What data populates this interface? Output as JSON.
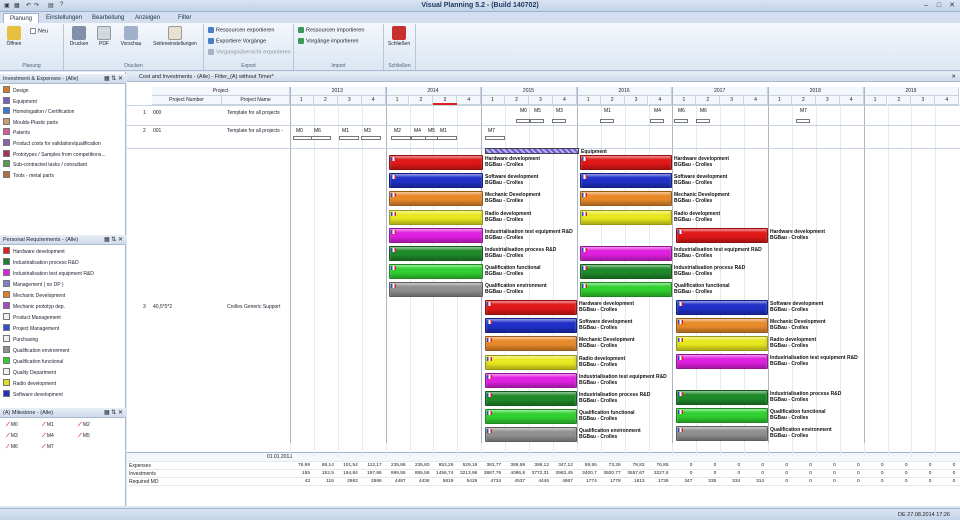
{
  "window": {
    "title": "Visual Planning 5.2 - (Build 140702)"
  },
  "tabs": [
    {
      "label": "Planung",
      "active": true
    },
    {
      "label": "Einstellungen"
    },
    {
      "label": "Bearbeitung"
    },
    {
      "label": "Anzeigen"
    },
    {
      "label": "Filter"
    }
  ],
  "ribbon": {
    "planung": {
      "label": "Planung",
      "open": "Öffnen",
      "new": "Neu"
    },
    "drucken": {
      "label": "Drucken",
      "print": "Drucken",
      "pdf": "PDF",
      "preview": "Vorschau",
      "page_setup": "Seiteneinstellungen"
    },
    "export": {
      "label": "Export",
      "res_export": "Ressourcen exportieren",
      "tasks_export": "Exportiere Vorgänge",
      "tasks_view_export": "Vorgangsübersicht exportieren"
    },
    "import": {
      "label": "Import",
      "res_import": "Ressourcen importieren",
      "tasks_import": "Vorgänge importieren"
    },
    "close": {
      "label": "Schließen",
      "close": "Schließen"
    }
  },
  "panels": {
    "invest": {
      "title": "Investment & Expenses - (Alle)",
      "items": [
        {
          "label": "Design",
          "color": "#d97a2a"
        },
        {
          "label": "Equipment",
          "color": "#7b5ec8"
        },
        {
          "label": "Homologation / Certification",
          "color": "#3a7ad8"
        },
        {
          "label": "Moulds-Plastic parts",
          "color": "#c8a070"
        },
        {
          "label": "Patents",
          "color": "#d85a9a"
        },
        {
          "label": "Product costs for validation/qualification",
          "color": "#9060b0"
        },
        {
          "label": "Prototypes / Samples from competitions...",
          "color": "#b03050"
        },
        {
          "label": "Sub-contracted tasks / consultant",
          "color": "#50a050"
        },
        {
          "label": "Tools - metal parts",
          "color": "#b07040"
        }
      ]
    },
    "personal": {
      "title": "Personal Requirements - (Alle)",
      "items": [
        {
          "label": "Hardware development",
          "color": "#e02020"
        },
        {
          "label": "Industrialisation process R&D",
          "color": "#208030"
        },
        {
          "label": "Industrialisation test equipment R&D",
          "color": "#e020e0"
        },
        {
          "label": "Management ( no DP )",
          "color": "#8080d0"
        },
        {
          "label": "Mechanic Development",
          "color": "#e08020"
        },
        {
          "label": "Mechanic prototyp dep.",
          "color": "#a050c0"
        },
        {
          "label": "Product Management",
          "color": "#f0f0f0"
        },
        {
          "label": "Project Management",
          "color": "#3050d0"
        },
        {
          "label": "Purchasing",
          "color": "#f0f0f0"
        },
        {
          "label": "Qualification environment",
          "color": "#909090"
        },
        {
          "label": "Qualification functional",
          "color": "#30d030"
        },
        {
          "label": "Quality Department",
          "color": "#f0f0f0"
        },
        {
          "label": "Radio development",
          "color": "#e0e020"
        },
        {
          "label": "Software development",
          "color": "#2030c0"
        }
      ]
    },
    "milestone": {
      "title": "(A) Milestone - (Alle)",
      "items": [
        "M0",
        "M1",
        "M2",
        "M3",
        "M4",
        "M5",
        "M6",
        "M7"
      ]
    }
  },
  "chart": {
    "title": "Cost and Investments - (Alle) - Filter_(A) without Timer*",
    "col_project": "Project",
    "col_number": "Project Number",
    "col_name": "Project Name",
    "years": [
      "2013",
      "2014",
      "2015",
      "2016",
      "2017",
      "2018",
      "2019"
    ],
    "quarters": [
      "1",
      "2",
      "3",
      "4"
    ],
    "rows": [
      {
        "idx": "1",
        "number": "000",
        "name": "Template for all projects"
      },
      {
        "idx": "2",
        "number": "001",
        "name": "Template for all projects -"
      },
      {
        "idx": "3",
        "number": "40,5*0*2",
        "name": "Crolles Generic Support"
      }
    ],
    "equipment_label": "Equipment",
    "date": "01.01.2013",
    "bar_sub": "BGBau - Crolles",
    "milestones_row1": [
      "M0",
      "M5",
      "M3",
      "M1",
      "M4",
      "M6",
      "M6",
      "M7"
    ],
    "milestones_row2": [
      "M0",
      "M6",
      "M1",
      "M3",
      "M2",
      "M4",
      "M5",
      "M1",
      "M7"
    ]
  },
  "tasks": {
    "hw": "Hardware development",
    "sw": "Software development",
    "mech": "Mechanic Development",
    "radio": "Radio development",
    "ind_test": "Industrialisation test equipment R&D",
    "ind_proc": "Industrialisation process R&D",
    "qual_func": "Qualification functional",
    "qual_env": "Qualification environment"
  },
  "colors": {
    "hw": "#e01818",
    "sw": "#2030c8",
    "mech": "#e88a2a",
    "radio": "#e8e820",
    "ind_test": "#e020e0",
    "ind_proc": "#1f8a2a",
    "qual_func": "#30d030",
    "qual_env": "#909090"
  },
  "summary": {
    "labels": [
      "Expenses",
      "Investments",
      "Required MD"
    ],
    "expenses": [
      "76,99",
      "88,14",
      "101,54",
      "112,17",
      "235,86",
      "235,80",
      "853,25",
      "529,16",
      "383,77",
      "389,59",
      "398,12",
      "347,12",
      "89,55",
      "73,26",
      "78,83",
      "76,85",
      "0",
      "0",
      "0",
      "0",
      "0",
      "0",
      "0",
      "0",
      "0",
      "0",
      "0",
      "0"
    ],
    "investments": [
      "155",
      "152,5",
      "194,84",
      "197,86",
      "999,55",
      "855,56",
      "1456,74",
      "3213,96",
      "3887,76",
      "4086,8",
      "3772,31",
      "3983,45",
      "3400,7",
      "3500,77",
      "3557,67",
      "3227,6",
      "0",
      "0",
      "0",
      "0",
      "0",
      "0",
      "0",
      "0",
      "0",
      "0",
      "0",
      "0"
    ],
    "required": [
      "43",
      "116",
      "2663",
      "2886",
      "4487",
      "4436",
      "5819",
      "5426",
      "4734",
      "4537",
      "4446",
      "4867",
      "1774",
      "1778",
      "1613",
      "1738",
      "347",
      "335",
      "334",
      "314",
      "0",
      "0",
      "0",
      "0",
      "0",
      "0",
      "0",
      "0"
    ]
  },
  "status": {
    "datetime": "DE 27.08.2014 17:26"
  }
}
